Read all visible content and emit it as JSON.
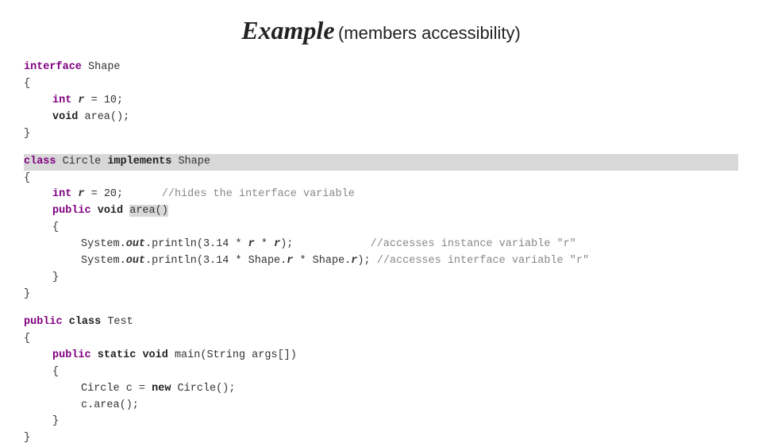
{
  "title": {
    "main": "Example",
    "sub": "(members accessibility)"
  },
  "code": {
    "interface_block": [
      "interface Shape",
      "{",
      "    int r = 10;",
      "    void area();",
      "}"
    ],
    "circle_block": [
      "class Circle implements Shape",
      "{",
      "    int r = 20;      //hides the interface variable",
      "    public void area()",
      "    {",
      "        System.out.println(3.14 * r * r);         //accesses instance variable \"r\"",
      "        System.out.println(3.14 * Shape.r * Shape.r); //accesses interface variable \"r\"",
      "    }",
      "}"
    ],
    "test_block": [
      "public class Test",
      "{",
      "    public static void main(String args[])",
      "    {",
      "        Circle c = new Circle();",
      "        c.area();",
      "    }",
      "}"
    ]
  }
}
